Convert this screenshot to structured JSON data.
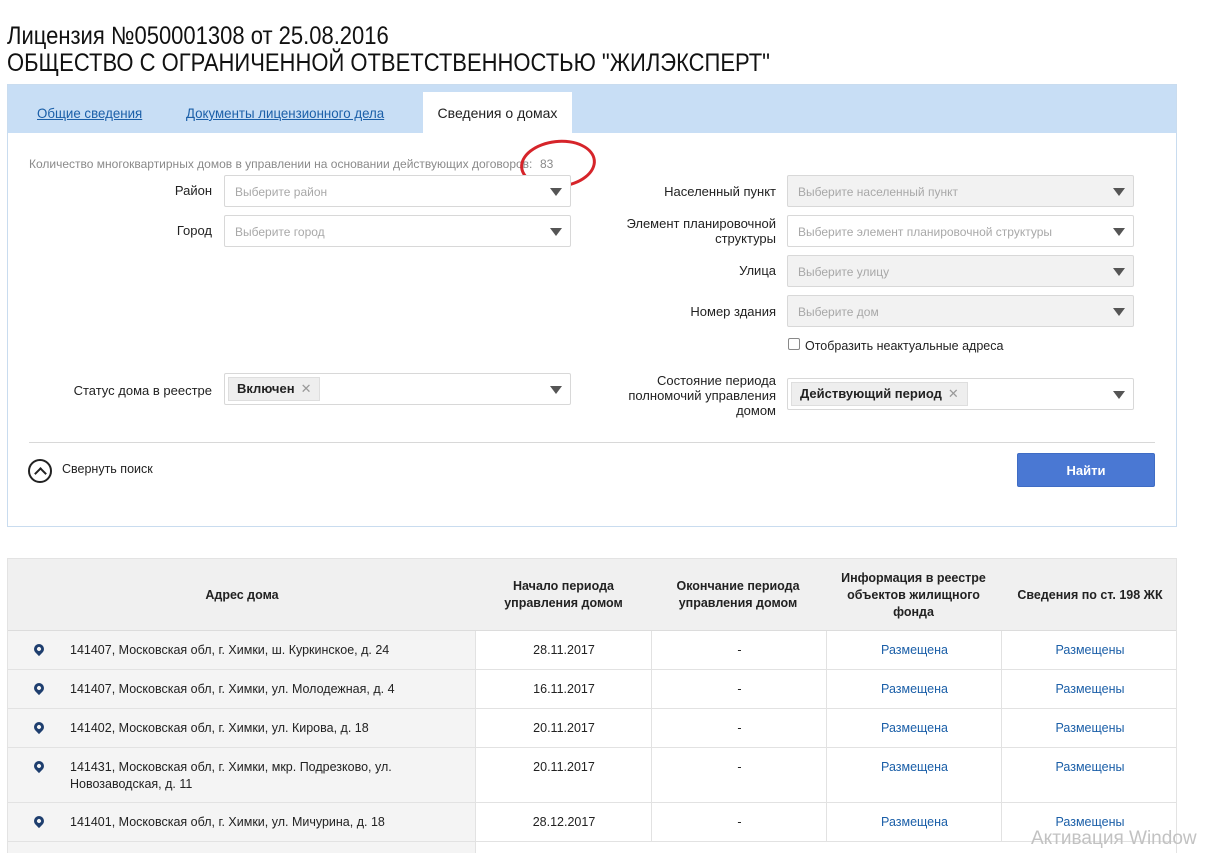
{
  "header": {
    "line1": "Лицензия №050001308 от 25.08.2016",
    "line2": "ОБЩЕСТВО С ОГРАНИЧЕННОЙ ОТВЕТСТВЕННОСТЬЮ \"ЖИЛЭКСПЕРТ\""
  },
  "tabs": [
    {
      "label": "Общие сведения"
    },
    {
      "label": "Документы лицензионного дела"
    },
    {
      "label": "Сведения о домах"
    }
  ],
  "summary": {
    "label": "Количество многоквартирных домов в управлении на основании действующих договоров:",
    "value": "83"
  },
  "filters": {
    "district": {
      "label": "Район",
      "placeholder": "Выберите район"
    },
    "city": {
      "label": "Город",
      "placeholder": "Выберите город"
    },
    "settlement": {
      "label": "Населенный пункт",
      "placeholder": "Выберите населенный пункт"
    },
    "planning": {
      "label": "Элемент планировочной структуры",
      "placeholder": "Выберите элемент планировочной структуры"
    },
    "street": {
      "label": "Улица",
      "placeholder": "Выберите улицу"
    },
    "building": {
      "label": "Номер здания",
      "placeholder": "Выберите дом"
    },
    "show_inactive": {
      "label": "Отобразить неактуальные адреса",
      "checked": false
    },
    "status": {
      "label": "Статус дома в реестре",
      "value": "Включен"
    },
    "period_state": {
      "label": "Состояние периода полномочий управления домом",
      "value": "Действующий период"
    }
  },
  "actions": {
    "collapse_label": "Свернуть поиск",
    "find_label": "Найти"
  },
  "table": {
    "columns": [
      "Адрес дома",
      "Начало периода управления домом",
      "Окончание периода управления домом",
      "Информация в реестре объектов жилищного фонда",
      "Сведения по ст. 198 ЖК"
    ],
    "rows": [
      {
        "address": "141407, Московская обл, г. Химки, ш. Куркинское, д. 24",
        "start": "28.11.2017",
        "end": "-",
        "registry": "Размещена",
        "art198": "Размещены"
      },
      {
        "address": "141407, Московская обл, г. Химки, ул. Молодежная, д. 4",
        "start": "16.11.2017",
        "end": "-",
        "registry": "Размещена",
        "art198": "Размещены"
      },
      {
        "address": "141402, Московская обл, г. Химки, ул. Кирова, д. 18",
        "start": "20.11.2017",
        "end": "-",
        "registry": "Размещена",
        "art198": "Размещены"
      },
      {
        "address": "141431, Московская обл, г. Химки, мкр. Подрезково, ул. Новозаводская, д. 11",
        "start": "20.11.2017",
        "end": "-",
        "registry": "Размещена",
        "art198": "Размещены"
      },
      {
        "address": "141401, Московская обл, г. Химки, ул. Мичурина, д. 18",
        "start": "28.12.2017",
        "end": "-",
        "registry": "Размещена",
        "art198": "Размещены"
      }
    ]
  },
  "watermark": "Активация Window",
  "colors": {
    "tab_bar": "#c8def5",
    "link": "#1b5fa8",
    "button": "#4a78d3",
    "annotation_circle": "#d6242a"
  }
}
